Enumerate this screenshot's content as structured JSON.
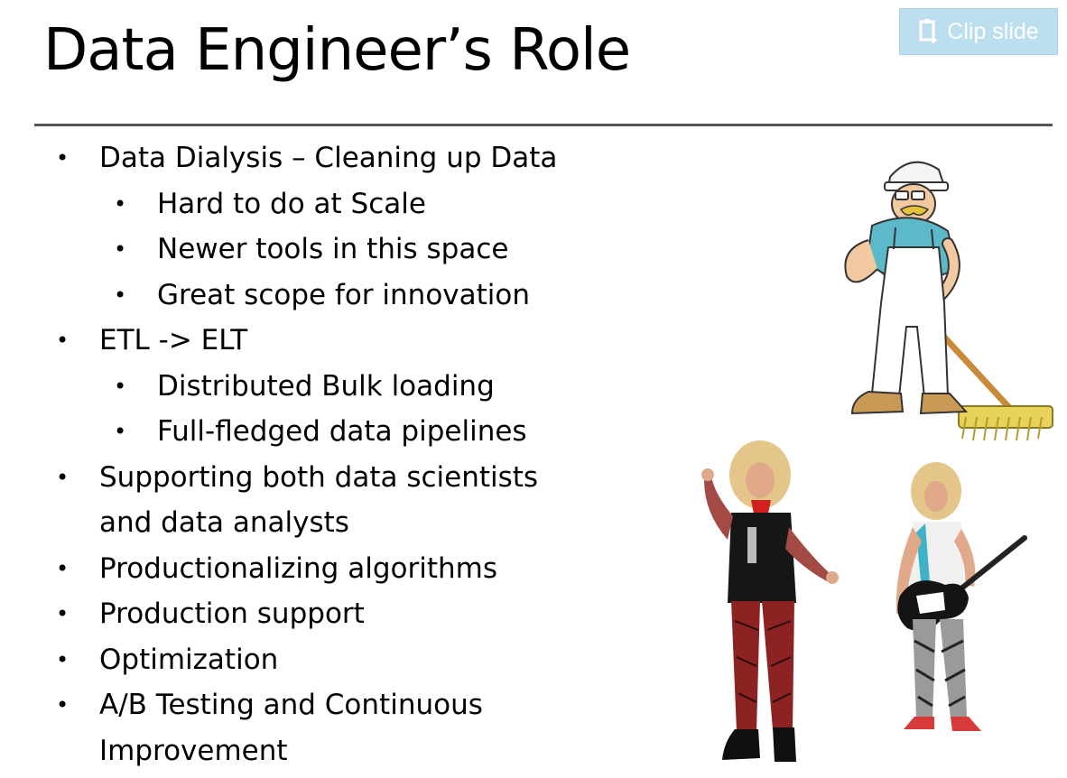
{
  "slide": {
    "title": "Data Engineer’s Role",
    "clip_button_label": "Clip slide",
    "bullets": [
      {
        "level": 1,
        "text": "Data Dialysis – Cleaning up Data"
      },
      {
        "level": 2,
        "text": "Hard to do at Scale"
      },
      {
        "level": 2,
        "text": "Newer tools in this space"
      },
      {
        "level": 2,
        "text": "Great scope for innovation"
      },
      {
        "level": 1,
        "text": "ETL -> ELT"
      },
      {
        "level": 2,
        "text": "Distributed Bulk loading"
      },
      {
        "level": 2,
        "text": "Full-fledged data pipelines"
      },
      {
        "level": 1,
        "text": "Supporting both data scientists and data analysts",
        "line1": "Supporting both data scientists",
        "line2": "and data analysts"
      },
      {
        "level": 1,
        "text": "Productionalizing algorithms"
      },
      {
        "level": 1,
        "text": "Production support"
      },
      {
        "level": 1,
        "text": "Optimization"
      },
      {
        "level": 1,
        "text": "A/B Testing and Continuous Improvement",
        "line1": "A/B Testing and Continuous",
        "line2": "Improvement"
      }
    ]
  },
  "icons": {
    "clip": "clip-icon"
  },
  "colors": {
    "clip_button_bg": "#bcdff0",
    "title_rule": "#555555",
    "text": "#000000"
  }
}
